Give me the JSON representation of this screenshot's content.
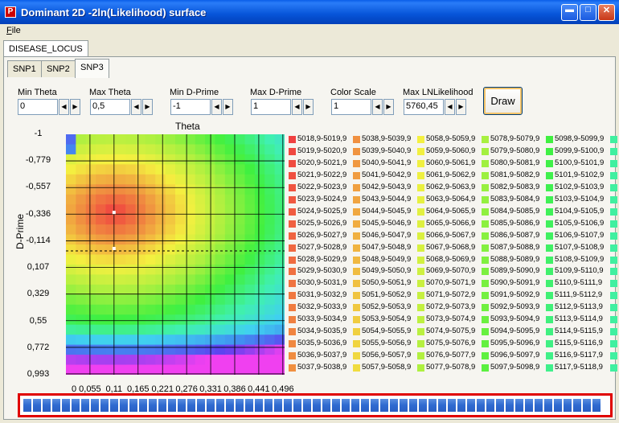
{
  "window": {
    "title": "Dominant 2D -2ln(Likelihood) surface",
    "icon": "app-icon"
  },
  "menu": {
    "file_label": "File",
    "file_underline": "F",
    "file_rest": "ile"
  },
  "outer_tab": {
    "label": "DISEASE_LOCUS"
  },
  "tabs": [
    {
      "label": "SNP1",
      "selected": false
    },
    {
      "label": "SNP2",
      "selected": false
    },
    {
      "label": "SNP3",
      "selected": true
    }
  ],
  "controls": {
    "min_theta": {
      "label": "Min Theta",
      "value": "0"
    },
    "max_theta": {
      "label": "Max Theta",
      "value": "0,5"
    },
    "min_dprime": {
      "label": "Min D-Prime",
      "value": "-1"
    },
    "max_dprime": {
      "label": "Max D-Prime",
      "value": "1"
    },
    "color_scale": {
      "label": "Color Scale",
      "value": "1"
    },
    "max_lnlikelihood": {
      "label": "Max LNLikelihood",
      "value": "5760,45"
    },
    "draw_label": "Draw"
  },
  "chart_data": {
    "type": "heatmap",
    "title": "Theta",
    "ylabel": "D-Prime",
    "xlabel": "",
    "x_ticks": [
      "0",
      "0,055",
      "0,11",
      "0,165",
      "0,221",
      "0,276",
      "0,331",
      "0,386",
      "0,441",
      "0,496"
    ],
    "y_ticks": [
      "-1",
      "-0,779",
      "-0,557",
      "-0,336",
      "-0,114",
      "0,107",
      "0,329",
      "0,55",
      "0,772",
      "0,993"
    ],
    "xlim": [
      0,
      0.5
    ],
    "ylim": [
      -1,
      1
    ],
    "minimum": {
      "theta": 0.11,
      "dprime": -0.35
    },
    "secondary_point": {
      "theta": 0.11,
      "dprime": -0.05
    },
    "dashed_line_dprime": -0.03,
    "colors": [
      "#f04040",
      "#f09040",
      "#f4f040",
      "#a8f040",
      "#40f040",
      "#40f0b0",
      "#40d0f0",
      "#4090f0",
      "#6040f0",
      "#f040f0"
    ],
    "legend_columns": [
      {
        "color": [
          "#f04040",
          "#f04a40",
          "#f05240",
          "#f04040",
          "#f05a3a",
          "#f06440",
          "#f06040",
          "#f06c3a",
          "#f07840",
          "#f07a40",
          "#f08040",
          "#f08440",
          "#f08840",
          "#f08a40",
          "#f08c40",
          "#f08e40",
          "#f09040",
          "#f09240"
        ],
        "labels": [
          "5018,9-5019,9",
          "5019,9-5020,9",
          "5020,9-5021,9",
          "5021,9-5022,9",
          "5022,9-5023,9",
          "5023,9-5024,9",
          "5024,9-5025,9",
          "5025,9-5026,9",
          "5026,9-5027,9",
          "5027,9-5028,9",
          "5028,9-5029,9",
          "5029,9-5030,9",
          "5030,9-5031,9",
          "5031,9-5032,9",
          "5032,9-5033,9",
          "5033,9-5034,9",
          "5034,9-5035,9",
          "5035,9-5036,9",
          "5036,9-5037,9",
          "5037,9-5038,9"
        ]
      },
      {
        "labels": [
          "5038,9-5039,9",
          "5039,9-5040,9",
          "5040,9-5041,9",
          "5041,9-5042,9",
          "5042,9-5043,9",
          "5043,9-5044,9",
          "5044,9-5045,9",
          "5045,9-5046,9",
          "5046,9-5047,9",
          "5047,9-5048,9",
          "5048,9-5049,9",
          "5049,9-5050,9",
          "5050,9-5051,9",
          "5051,9-5052,9",
          "5052,9-5053,9",
          "5053,9-5054,9",
          "5054,9-5055,9",
          "5055,9-5056,9",
          "5056,9-5057,9",
          "5057,9-5058,9"
        ]
      },
      {
        "labels": [
          "5058,9-5059,9",
          "5059,9-5060,9",
          "5060,9-5061,9",
          "5061,9-5062,9",
          "5062,9-5063,9",
          "5063,9-5064,9",
          "5064,9-5065,9",
          "5065,9-5066,9",
          "5066,9-5067,9",
          "5067,9-5068,9",
          "5068,9-5069,9",
          "5069,9-5070,9",
          "5070,9-5071,9",
          "5071,9-5072,9",
          "5072,9-5073,9",
          "5073,9-5074,9",
          "5074,9-5075,9",
          "5075,9-5076,9",
          "5076,9-5077,9",
          "5077,9-5078,9"
        ]
      },
      {
        "labels": [
          "5078,9-5079,9",
          "5079,9-5080,9",
          "5080,9-5081,9",
          "5081,9-5082,9",
          "5082,9-5083,9",
          "5083,9-5084,9",
          "5084,9-5085,9",
          "5085,9-5086,9",
          "5086,9-5087,9",
          "5087,9-5088,9",
          "5088,9-5089,9",
          "5089,9-5090,9",
          "5090,9-5091,9",
          "5091,9-5092,9",
          "5092,9-5093,9",
          "5093,9-5094,9",
          "5094,9-5095,9",
          "5095,9-5096,9",
          "5096,9-5097,9",
          "5097,9-5098,9"
        ]
      },
      {
        "labels": [
          "5098,9-5099,9",
          "5099,9-5100,9",
          "5100,9-5101,9",
          "5101,9-5102,9",
          "5102,9-5103,9",
          "5103,9-5104,9",
          "5104,9-5105,9",
          "5105,9-5106,9",
          "5106,9-5107,9",
          "5107,9-5108,9",
          "5108,9-5109,9",
          "5109,9-5110,9",
          "5110,9-5111,9",
          "5111,9-5112,9",
          "5112,9-5113,9",
          "5113,9-5114,9",
          "5114,9-5115,9",
          "5115,9-5116,9",
          "5116,9-5117,9",
          "5117,9-5118,9"
        ]
      }
    ]
  },
  "progress": {
    "value_percent": 100,
    "color": "#2f6ad0",
    "frame_color": "#e00000"
  }
}
